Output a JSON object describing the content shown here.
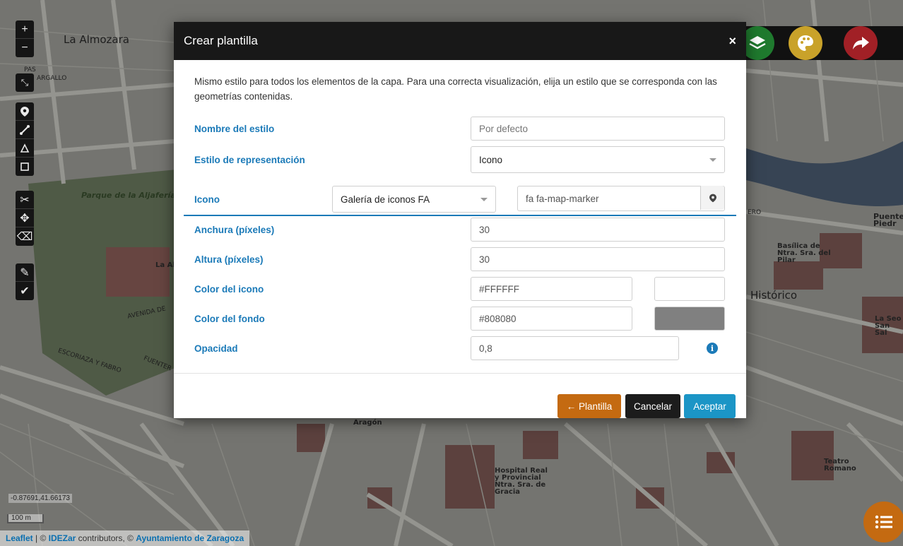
{
  "map": {
    "labels": {
      "almozara": "La Almozara",
      "aljaferia_park": "Parque de la Aljafería",
      "la_al": "La Al",
      "historico": "Histórico",
      "basilica": "Basílica de Ntra. Sra. del Pilar",
      "puente": "Puente Piedr",
      "la_seo": "La Seo San Sal",
      "aragon": "Aragón",
      "hospital": "Hospital Real y Provincial Ntra. Sra. de Gracia",
      "teatro": "Teatro Romano",
      "escoriaza": "ESCORIAZA Y FABRO",
      "avenida": "AVENIDA DE",
      "fuenter": "FUENTER",
      "gallo": "ARGALLO",
      "pas": "PAS",
      "ero": "ERO"
    },
    "coords": "-0.87691,41.66173",
    "scale": "100 m",
    "attribution": {
      "leaflet": "Leaflet",
      "sep": " | © ",
      "idezar": "IDEZar",
      "contrib": " contributors, © ",
      "ayto": "Ayuntamiento de Zaragoza"
    }
  },
  "toolbar": {
    "zoom_in": "+",
    "zoom_out": "−"
  },
  "colors": {
    "layers_button": "#1f7a2e",
    "palette_button": "#c9a22a",
    "share_button": "#a12026",
    "accent": "#1b7ab8",
    "template_button": "#c46a11",
    "cancel_button": "#1c1c1c",
    "accept_button": "#1b95c6"
  },
  "modal": {
    "title": "Crear plantilla",
    "close": "×",
    "intro": "Mismo estilo para todos los elementos de la capa. Para una correcta visualización, elija un estilo que se corresponda con las geometrías contenidas.",
    "style_name": {
      "label": "Nombre del estilo",
      "placeholder": "Por defecto"
    },
    "representation": {
      "label": "Estilo de representación",
      "value": "Icono"
    },
    "icon": {
      "label": "Icono",
      "gallery": "Galería de iconos FA",
      "icon_class": "fa fa-map-marker"
    },
    "width": {
      "label": "Anchura (píxeles)",
      "value": "30"
    },
    "height": {
      "label": "Altura (píxeles)",
      "value": "30"
    },
    "icon_color": {
      "label": "Color del icono",
      "value": "#FFFFFF",
      "swatch": "#FFFFFF"
    },
    "bg_color": {
      "label": "Color del fondo",
      "value": "#808080",
      "swatch": "#808080"
    },
    "opacity": {
      "label": "Opacidad",
      "value": "0,8"
    },
    "buttons": {
      "template": "← Plantilla",
      "cancel": "Cancelar",
      "accept": "Aceptar"
    }
  }
}
